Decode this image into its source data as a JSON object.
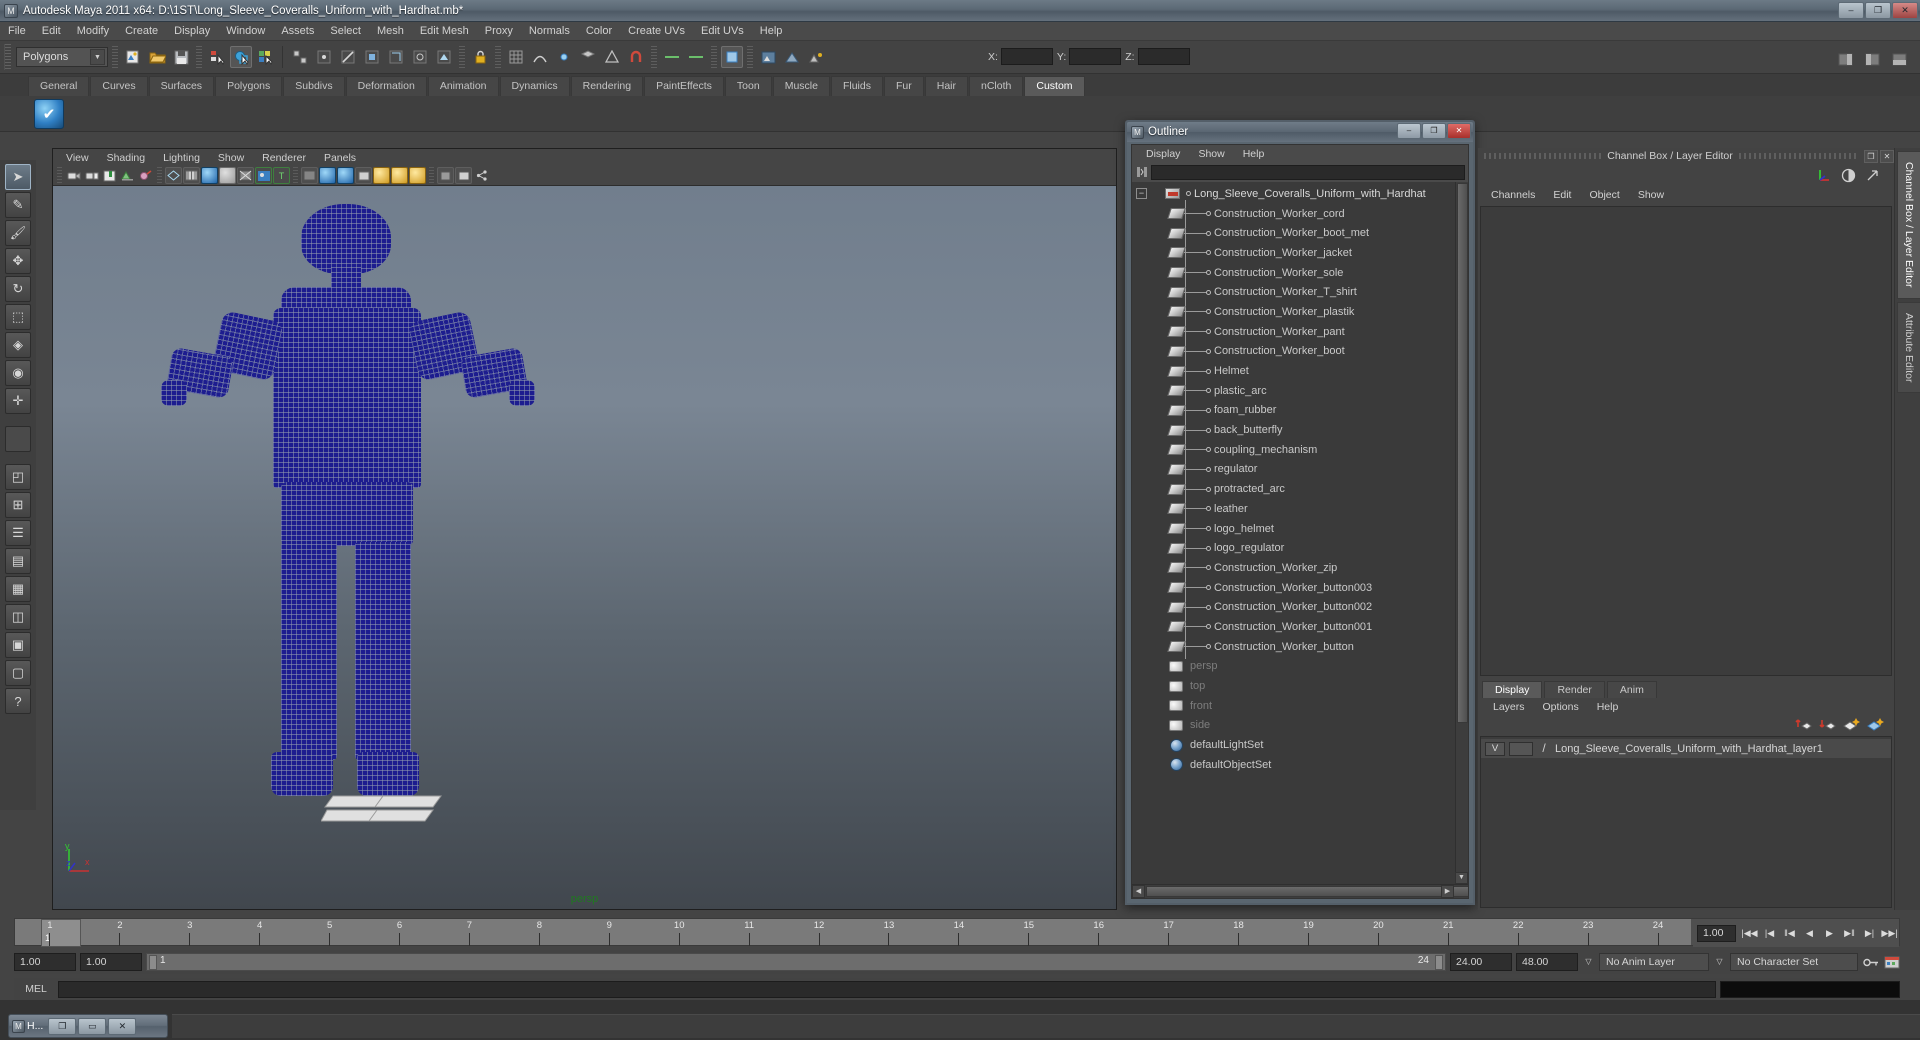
{
  "window": {
    "title": "Autodesk Maya 2011 x64: D:\\1ST\\Long_Sleeve_Coveralls_Uniform_with_Hardhat.mb*",
    "app_icon": "maya-icon",
    "minimize": "–",
    "maximize": "❐",
    "close": "✕"
  },
  "menubar": {
    "items": [
      "File",
      "Edit",
      "Modify",
      "Create",
      "Display",
      "Window",
      "Assets",
      "Select",
      "Mesh",
      "Edit Mesh",
      "Proxy",
      "Normals",
      "Color",
      "Create UVs",
      "Edit UVs",
      "Help"
    ]
  },
  "statusline": {
    "mode": "Polygons",
    "mode_arrow": "▼",
    "coord_labels": [
      "X:",
      "Y:",
      "Z:"
    ],
    "coord_values": [
      "",
      "",
      ""
    ],
    "icons": [
      "new-scene-icon",
      "open-scene-icon",
      "save-scene-icon",
      "select-by-hierarchy-icon",
      "select-by-object-icon",
      "select-by-component-icon",
      "handle-icon",
      "highlight-icon",
      "vertex-icon",
      "edge-icon",
      "face-icon",
      "uv-icon",
      "lock-icon",
      "snap-grid-icon",
      "snap-curve-icon",
      "snap-point-icon",
      "snap-view-icon",
      "snap-live-icon",
      "history-icon",
      "render-icon",
      "render-sequence-icon",
      "ipr-icon",
      "render-settings-icon",
      "show-manipulator-icon",
      "selection-mask-icon"
    ]
  },
  "shelf": {
    "tabs": [
      "General",
      "Curves",
      "Surfaces",
      "Polygons",
      "Subdivs",
      "Deformation",
      "Animation",
      "Dynamics",
      "Rendering",
      "PaintEffects",
      "Toon",
      "Muscle",
      "Fluids",
      "Fur",
      "Hair",
      "nCloth",
      "Custom"
    ],
    "active_tab": "Custom",
    "buttons": [
      {
        "name": "custom-shelf-button",
        "glyph": "✔"
      }
    ]
  },
  "toolbox": {
    "items": [
      {
        "name": "select-tool",
        "glyph": "➤",
        "selected": true
      },
      {
        "name": "lasso-select-tool",
        "glyph": "✎"
      },
      {
        "name": "paint-select-tool",
        "glyph": "🖌"
      },
      {
        "name": "move-tool",
        "glyph": "✥"
      },
      {
        "name": "rotate-tool",
        "glyph": "↻"
      },
      {
        "name": "scale-tool",
        "glyph": "⬚"
      },
      {
        "name": "universal-manipulator-tool",
        "glyph": "◈"
      },
      {
        "name": "soft-modification-tool",
        "glyph": "◉"
      },
      {
        "name": "show-manipulator-tool",
        "glyph": "✛"
      },
      {
        "name": "last-tool-used",
        "glyph": ""
      },
      {
        "name": "quick-layout-persp",
        "glyph": "◰"
      },
      {
        "name": "quick-layout-four",
        "glyph": "⊞"
      },
      {
        "name": "quick-layout-outliner",
        "glyph": "☰"
      },
      {
        "name": "quick-layout-persp-graph",
        "glyph": "▤"
      },
      {
        "name": "quick-layout-hypershade",
        "glyph": "▦"
      },
      {
        "name": "quick-layout-persp-persp",
        "glyph": "◫"
      },
      {
        "name": "quick-layout-hypergraph",
        "glyph": "▣"
      },
      {
        "name": "quick-layout-more",
        "glyph": "▢"
      },
      {
        "name": "help-tool",
        "glyph": "?"
      }
    ]
  },
  "viewport": {
    "menus": [
      "View",
      "Shading",
      "Lighting",
      "Show",
      "Renderer",
      "Panels"
    ],
    "toolbar_icons": [
      "camera-icon",
      "camera-attributes-icon",
      "bookmark-icon",
      "image-plane-icon",
      "grease-pencil-icon",
      "wireframe-icon",
      "smooth-shade-icon",
      "shaded-icon",
      "shaded-textured-icon",
      "wireframe-on-shaded-icon",
      "lighting-icon",
      "xray-icon",
      "isolate-select-icon",
      "shadows-icon",
      "exposure-icon",
      "gamma-icon",
      "viewcube-icon",
      "snapshot-icon"
    ],
    "camera_label": "persp",
    "axis": {
      "x": "x",
      "y": "y",
      "z": "z",
      "x_color": "#c83232",
      "y_color": "#32c832",
      "z_color": "#3232c8"
    },
    "wireframe_color": "#1d1d8f",
    "background_top": "#717e8d",
    "background_bottom": "#41474e"
  },
  "outliner": {
    "title": "Outliner",
    "window_icon": "maya-icon",
    "buttons": {
      "minimize": "–",
      "maximize": "❐",
      "close": "✕"
    },
    "menus": [
      "Display",
      "Show",
      "Help"
    ],
    "search_placeholder": "",
    "search_value": "",
    "filter_icon": "filter-icon",
    "root": {
      "label": "Long_Sleeve_Coveralls_Uniform_with_Hardhat",
      "expander": "−",
      "icon": "transform-icon"
    },
    "children": [
      "Construction_Worker_cord",
      "Construction_Worker_boot_met",
      "Construction_Worker_jacket",
      "Construction_Worker_sole",
      "Construction_Worker_T_shirt",
      "Construction_Worker_plastik",
      "Construction_Worker_pant",
      "Construction_Worker_boot",
      "Helmet",
      "plastic_arc",
      "foam_rubber",
      "back_butterfly",
      "coupling_mechanism",
      "regulator",
      "protracted_arc",
      "leather",
      "logo_helmet",
      "logo_regulator",
      "Construction_Worker_zip",
      "Construction_Worker_button003",
      "Construction_Worker_button002",
      "Construction_Worker_button001",
      "Construction_Worker_button"
    ],
    "cameras": [
      "persp",
      "top",
      "front",
      "side"
    ],
    "sets": [
      "defaultLightSet",
      "defaultObjectSet"
    ],
    "scroll_up": "▲",
    "scroll_down": "▼",
    "scroll_left": "◀",
    "scroll_right": "▶"
  },
  "right_dock": {
    "title": "Channel Box / Layer Editor",
    "float_button": "❐",
    "close_button": "✕",
    "header_icons": [
      "axis-icon",
      "render-channel-icon",
      "expand-icon"
    ],
    "menus": [
      "Channels",
      "Edit",
      "Object",
      "Show"
    ],
    "layer_tabs": [
      "Display",
      "Render",
      "Anim"
    ],
    "active_layer_tab": "Display",
    "layer_menus": [
      "Layers",
      "Options",
      "Help"
    ],
    "layer_toolbar_icons": [
      "move-layer-up-icon",
      "move-layer-down-icon",
      "new-layer-icon",
      "new-layer-from-selected-icon"
    ],
    "layers": [
      {
        "visibility": "V",
        "shading": "",
        "template": "/",
        "name": "Long_Sleeve_Coveralls_Uniform_with_Hardhat_layer1"
      }
    ],
    "vertical_tabs": [
      "Channel Box / Layer Editor",
      "Attribute Editor"
    ]
  },
  "timeline": {
    "ticks": [
      1,
      2,
      3,
      4,
      5,
      6,
      7,
      8,
      9,
      10,
      11,
      12,
      13,
      14,
      15,
      16,
      17,
      18,
      19,
      20,
      21,
      22,
      23,
      24
    ],
    "current_frame": "1",
    "current_frame_field": "1.00",
    "playback_buttons": [
      "go-to-start-icon",
      "step-back-frame-icon",
      "step-back-key-icon",
      "play-backwards-icon",
      "play-forwards-icon",
      "step-forward-key-icon",
      "step-forward-frame-icon",
      "go-to-end-icon"
    ]
  },
  "range": {
    "start_field": "1.00",
    "end_field": "1.00",
    "range_start_label": "1",
    "range_end_label": "24",
    "playback_start": "24.00",
    "playback_end": "48.00",
    "anim_layer": "No Anim Layer",
    "character_set": "No Character Set",
    "dropdown_arrow": "▽",
    "right_icons": [
      "auto-key-icon",
      "animation-preferences-icon"
    ]
  },
  "mel": {
    "label": "MEL",
    "value": "",
    "placeholder": ""
  },
  "taskbar": {
    "icon": "maya-icon",
    "label": "H...",
    "restore": "❐",
    "maximize": "▭",
    "close": "✕"
  }
}
